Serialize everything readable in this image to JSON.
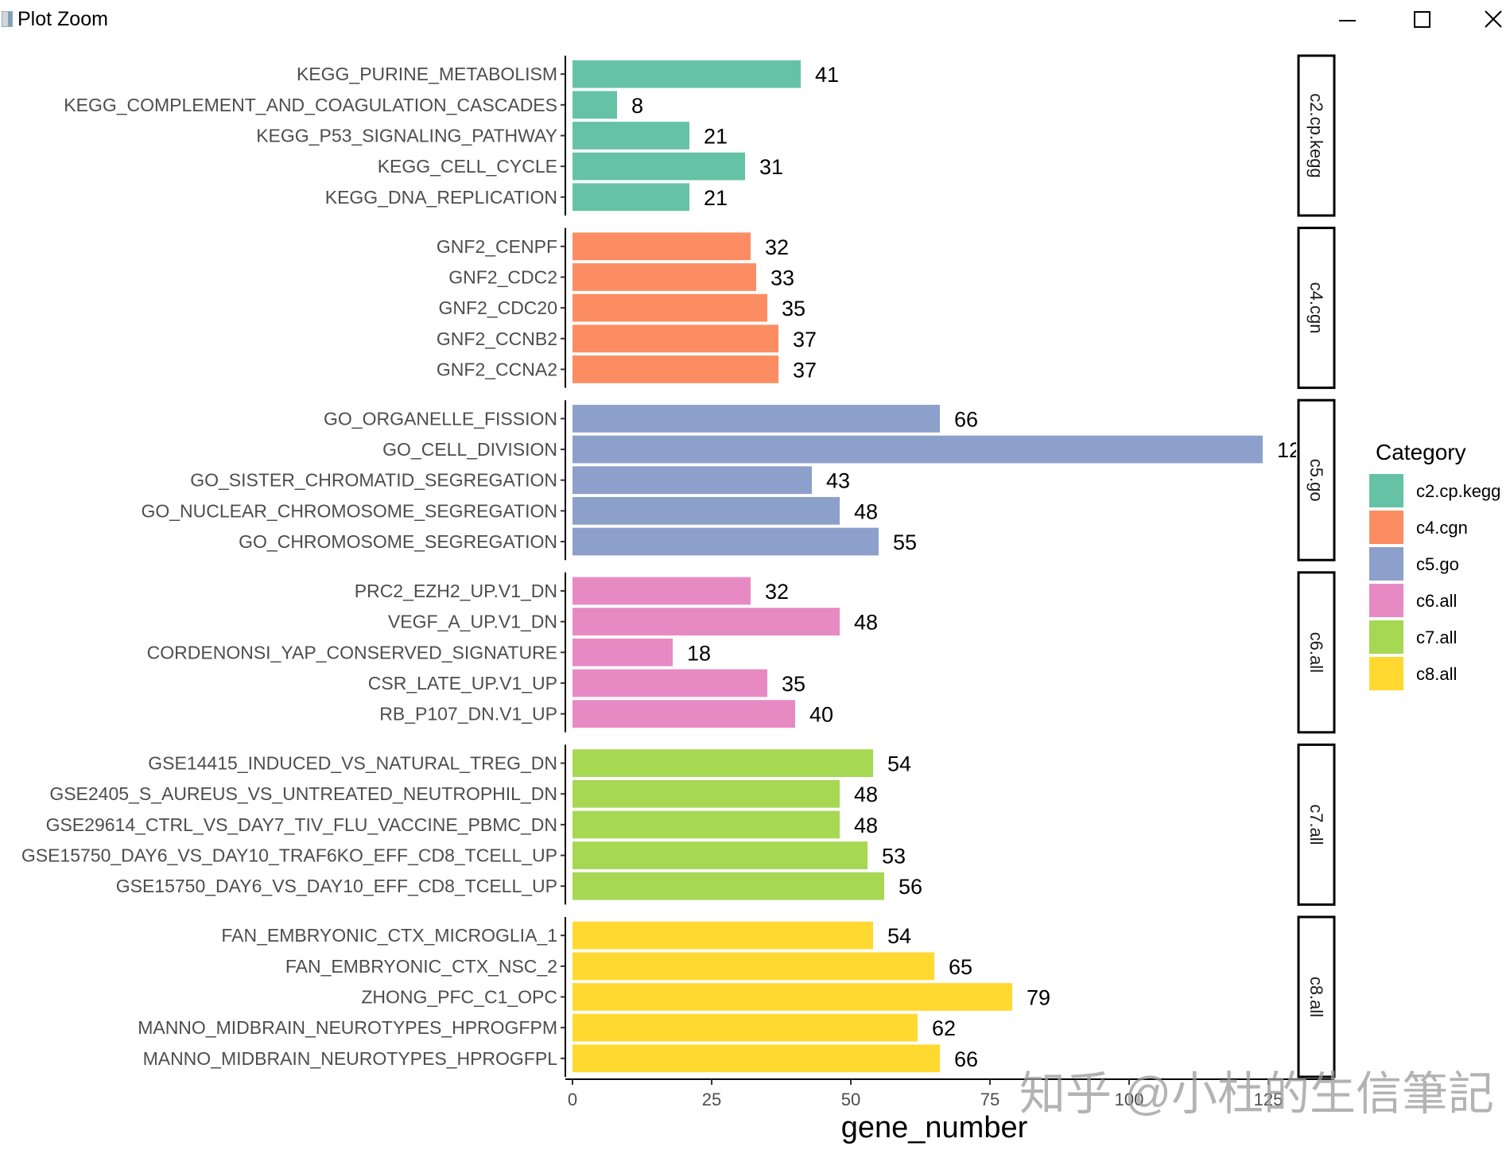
{
  "window": {
    "title": "Plot Zoom",
    "controls": {
      "minimize": "minimize-icon",
      "maximize": "maximize-icon",
      "close": "close-icon"
    }
  },
  "watermark": "知乎 @小杜的生信筆記",
  "chart_data": {
    "type": "bar",
    "orientation": "horizontal",
    "faceted": true,
    "xlabel": "gene_number",
    "ylabel": "",
    "xlim": [
      0,
      130
    ],
    "xticks": [
      0,
      25,
      50,
      75,
      100,
      125
    ],
    "grid": false,
    "legend": {
      "title": "Category",
      "position": "right",
      "entries": [
        {
          "label": "c2.cp.kegg",
          "color": "#66C2A5"
        },
        {
          "label": "c4.cgn",
          "color": "#FC8D62"
        },
        {
          "label": "c5.go",
          "color": "#8DA0CB"
        },
        {
          "label": "c6.all",
          "color": "#E78AC3"
        },
        {
          "label": "c7.all",
          "color": "#A6D854"
        },
        {
          "label": "c8.all",
          "color": "#FFD92F"
        }
      ]
    },
    "facets": [
      {
        "strip": "c2.cp.kegg",
        "color": "#66C2A5",
        "bars": [
          {
            "label": "KEGG_PURINE_METABOLISM",
            "value": 41,
            "text": "41"
          },
          {
            "label": "KEGG_COMPLEMENT_AND_COAGULATION_CASCADES",
            "value": 8,
            "text": "8"
          },
          {
            "label": "KEGG_P53_SIGNALING_PATHWAY",
            "value": 21,
            "text": "21"
          },
          {
            "label": "KEGG_CELL_CYCLE",
            "value": 31,
            "text": "31"
          },
          {
            "label": "KEGG_DNA_REPLICATION",
            "value": 21,
            "text": "21"
          }
        ]
      },
      {
        "strip": "c4.cgn",
        "color": "#FC8D62",
        "bars": [
          {
            "label": "GNF2_CENPF",
            "value": 32,
            "text": "32"
          },
          {
            "label": "GNF2_CDC2",
            "value": 33,
            "text": "33"
          },
          {
            "label": "GNF2_CDC20",
            "value": 35,
            "text": "35"
          },
          {
            "label": "GNF2_CCNB2",
            "value": 37,
            "text": "37"
          },
          {
            "label": "GNF2_CCNA2",
            "value": 37,
            "text": "37"
          }
        ]
      },
      {
        "strip": "c5.go",
        "color": "#8DA0CB",
        "bars": [
          {
            "label": "GO_ORGANELLE_FISSION",
            "value": 66,
            "text": "66"
          },
          {
            "label": "GO_CELL_DIVISION",
            "value": 124,
            "text": "12"
          },
          {
            "label": "GO_SISTER_CHROMATID_SEGREGATION",
            "value": 43,
            "text": "43"
          },
          {
            "label": "GO_NUCLEAR_CHROMOSOME_SEGREGATION",
            "value": 48,
            "text": "48"
          },
          {
            "label": "GO_CHROMOSOME_SEGREGATION",
            "value": 55,
            "text": "55"
          }
        ]
      },
      {
        "strip": "c6.all",
        "color": "#E78AC3",
        "bars": [
          {
            "label": "PRC2_EZH2_UP.V1_DN",
            "value": 32,
            "text": "32"
          },
          {
            "label": "VEGF_A_UP.V1_DN",
            "value": 48,
            "text": "48"
          },
          {
            "label": "CORDENONSI_YAP_CONSERVED_SIGNATURE",
            "value": 18,
            "text": "18"
          },
          {
            "label": "CSR_LATE_UP.V1_UP",
            "value": 35,
            "text": "35"
          },
          {
            "label": "RB_P107_DN.V1_UP",
            "value": 40,
            "text": "40"
          }
        ]
      },
      {
        "strip": "c7.all",
        "color": "#A6D854",
        "bars": [
          {
            "label": "GSE14415_INDUCED_VS_NATURAL_TREG_DN",
            "value": 54,
            "text": "54"
          },
          {
            "label": "GSE2405_S_AUREUS_VS_UNTREATED_NEUTROPHIL_DN",
            "value": 48,
            "text": "48"
          },
          {
            "label": "GSE29614_CTRL_VS_DAY7_TIV_FLU_VACCINE_PBMC_DN",
            "value": 48,
            "text": "48"
          },
          {
            "label": "GSE15750_DAY6_VS_DAY10_TRAF6KO_EFF_CD8_TCELL_UP",
            "value": 53,
            "text": "53"
          },
          {
            "label": "GSE15750_DAY6_VS_DAY10_EFF_CD8_TCELL_UP",
            "value": 56,
            "text": "56"
          }
        ]
      },
      {
        "strip": "c8.all",
        "color": "#FFD92F",
        "bars": [
          {
            "label": "FAN_EMBRYONIC_CTX_MICROGLIA_1",
            "value": 54,
            "text": "54"
          },
          {
            "label": "FAN_EMBRYONIC_CTX_NSC_2",
            "value": 65,
            "text": "65"
          },
          {
            "label": "ZHONG_PFC_C1_OPC",
            "value": 79,
            "text": "79"
          },
          {
            "label": "MANNO_MIDBRAIN_NEUROTYPES_HPROGFPM",
            "value": 62,
            "text": "62"
          },
          {
            "label": "MANNO_MIDBRAIN_NEUROTYPES_HPROGFPL",
            "value": 66,
            "text": "66"
          }
        ]
      }
    ]
  }
}
